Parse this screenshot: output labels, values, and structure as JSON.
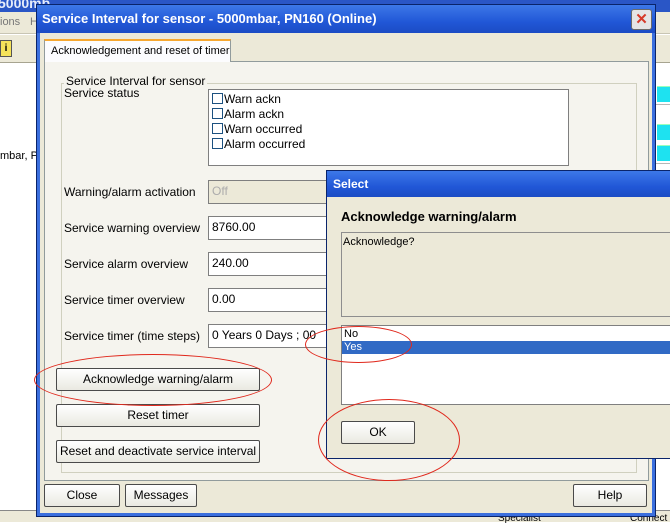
{
  "background": {
    "title": "5000mb...",
    "menu_left": "ions",
    "menu_right": "H",
    "toolbar_icon_label": "i",
    "sensor_truncated": "mbar, PN",
    "statusbar_left": "Specialist",
    "statusbar_right": "Connect"
  },
  "dialog": {
    "title": "Service Interval for sensor  - 5000mbar, PN160  (Online)",
    "close_glyph": "✕",
    "tab_label": "Acknowledgement and reset of timer",
    "group_title": "Service Interval for sensor",
    "service_status_label": "Service status",
    "status_flags": [
      "Warn ackn",
      "Alarm ackn",
      "Warn occurred",
      "Alarm occurred"
    ],
    "fields": {
      "activation": {
        "label": "Warning/alarm activation",
        "value": "Off"
      },
      "warning_overview": {
        "label": "Service warning overview",
        "value": "8760.00"
      },
      "alarm_overview": {
        "label": "Service alarm overview",
        "value": "240.00"
      },
      "timer_overview": {
        "label": "Service timer overview",
        "value": "0.00"
      },
      "timer_steps": {
        "label": "Service timer (time steps)",
        "value": "0 Years  0 Days  ; 00"
      }
    },
    "buttons": {
      "acknowledge": "Acknowledge warning/alarm",
      "reset_timer": "Reset timer",
      "reset_deactivate": "Reset and deactivate service interval",
      "close": "Close",
      "messages": "Messages",
      "help": "Help"
    }
  },
  "select_dialog": {
    "title": "Select",
    "heading": "Acknowledge warning/alarm",
    "message": "Acknowledge?",
    "options": [
      "No",
      "Yes"
    ],
    "selected_option": "Yes",
    "ok_label": "OK"
  },
  "colors": {
    "titlebar": "#2157d7",
    "dialog_face": "#ece9d8",
    "selection": "#316ac5",
    "annotation": "#e0281c",
    "status_cyan": "#1ee2f0"
  }
}
